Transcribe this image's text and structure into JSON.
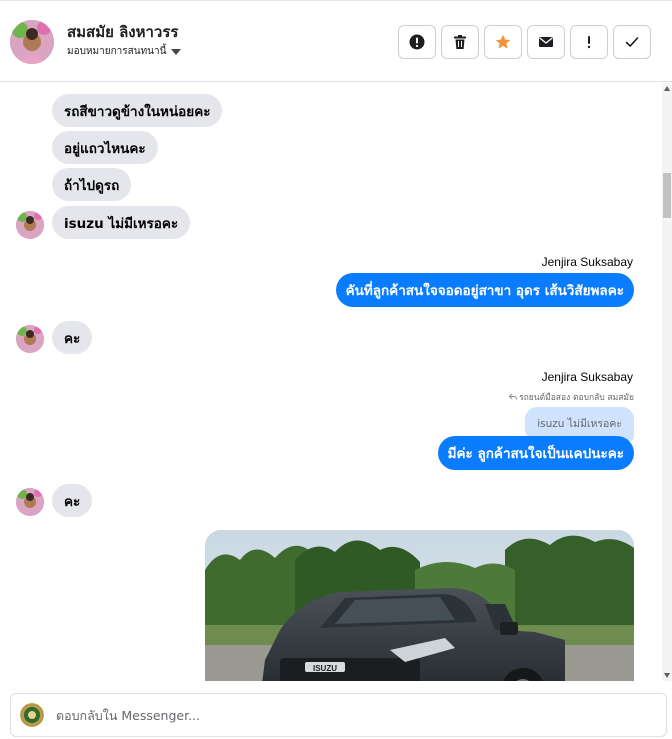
{
  "header": {
    "contact_name": "สมสมัย ลิงหาวรร",
    "assign_label": "มอบหมายการสนทนานี้",
    "actions": [
      {
        "name": "mark-spam",
        "icon": "exclamation-circle-icon"
      },
      {
        "name": "delete",
        "icon": "trash-icon"
      },
      {
        "name": "star",
        "icon": "star-icon"
      },
      {
        "name": "mark-unread",
        "icon": "envelope-icon"
      },
      {
        "name": "follow-up",
        "icon": "exclamation-icon"
      },
      {
        "name": "done",
        "icon": "checkmark-icon"
      }
    ]
  },
  "colors": {
    "outgoing_bubble": "#0a7cff",
    "incoming_bubble": "#e4e6eb",
    "quoted_bubble": "#cfe3ff",
    "star_accent": "#f5933d"
  },
  "messages": {
    "in_1": "รถสีขาวดูข้างในหน่อยคะ",
    "in_2": "อยู่แถวไหนคะ",
    "in_3": "ถ้าไปดูรถ",
    "in_4": "isuzu ไม่มีเหรอคะ",
    "out_1_sender": "Jenjira Suksabay",
    "out_1": "คันที่ลูกค้าสนใจจอดอยู่สาขา อุดร เส้นวิสัยพลคะ",
    "in_5": "คะ",
    "out_2_sender": "Jenjira Suksabay",
    "out_2_reply_note": "รถยนต์มือสอง ตอบกลับ สมสมัย",
    "out_2_quoted": "isuzu ไม่มีเหรอคะ",
    "out_2": "มีค่ะ ลูกค้าสนใจเป็นแคปนะคะ",
    "in_6": "คะ"
  },
  "composer": {
    "placeholder": "ตอบกลับใน Messenger..."
  }
}
